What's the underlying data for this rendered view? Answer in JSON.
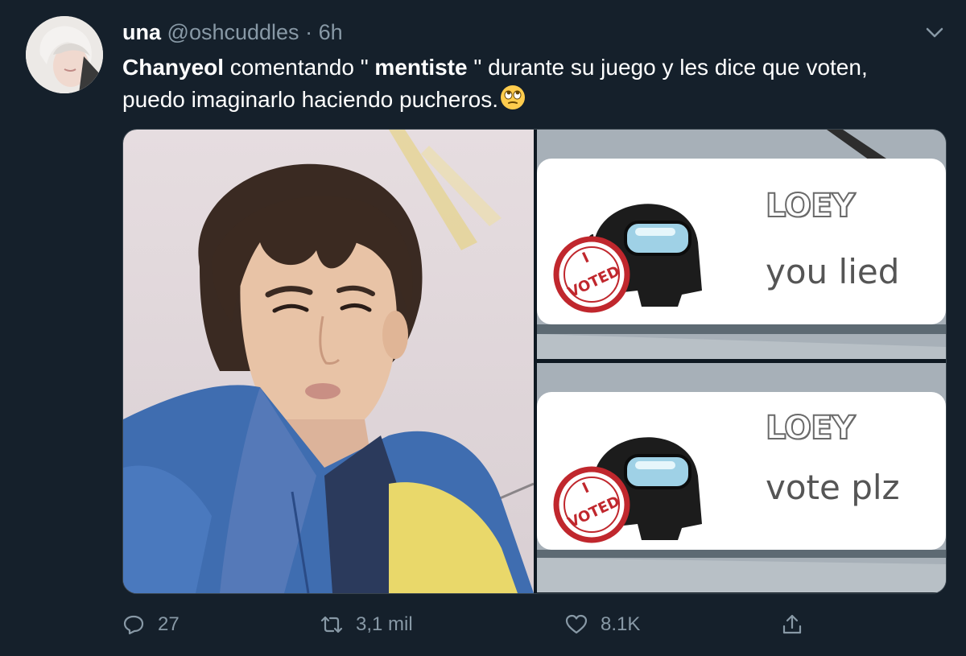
{
  "tweet": {
    "display_name": "una",
    "handle": "@oshcuddles",
    "separator": "·",
    "time": "6h",
    "text_bold_1": "Chanyeol",
    "text_part_1": " comentando \" ",
    "text_bold_2": "mentiste",
    "text_part_2": " \" durante su juego y les dice que voten, puedo imaginarlo haciendo pucheros.",
    "emoji": "face-with-rolling-eyes"
  },
  "media": {
    "panel1": {
      "name": "LOEY",
      "message": "you lied",
      "stamp_top": "I",
      "stamp_bottom": "VOTED"
    },
    "panel2": {
      "name": "LOEY",
      "message": "vote plz",
      "stamp_top": "I",
      "stamp_bottom": "VOTED"
    }
  },
  "actions": {
    "reply_count": "27",
    "retweet_count": "3,1 mil",
    "like_count": "8.1K"
  },
  "colors": {
    "background": "#15202b",
    "secondary_text": "#8899a6",
    "border": "#38444d"
  }
}
